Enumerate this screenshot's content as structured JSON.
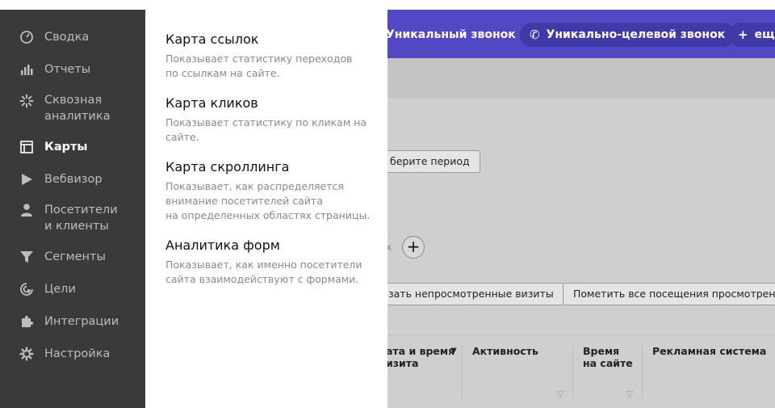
{
  "sidebar": {
    "items": [
      {
        "label": "Сводка",
        "icon": "gauge-icon",
        "active": false
      },
      {
        "label": "Отчеты",
        "icon": "bar-chart-icon",
        "active": false
      },
      {
        "label": "Сквозная\nаналитика",
        "icon": "loader-icon",
        "active": false
      },
      {
        "label": "Карты",
        "icon": "map-layout-icon",
        "active": true
      },
      {
        "label": "Вебвизор",
        "icon": "play-icon",
        "active": false
      },
      {
        "label": "Посетители\nи клиенты",
        "icon": "person-icon",
        "active": false
      },
      {
        "label": "Сегменты",
        "icon": "funnel-icon",
        "active": false
      },
      {
        "label": "Цели",
        "icon": "target-cursor-icon",
        "active": false
      },
      {
        "label": "Интеграции",
        "icon": "puzzle-icon",
        "active": false
      },
      {
        "label": "Настройка",
        "icon": "gear-icon",
        "active": false
      }
    ]
  },
  "flyout": {
    "items": [
      {
        "title": "Карта ссылок",
        "desc": "Показывает статистику переходов\nпо ссылкам на сайте."
      },
      {
        "title": "Карта кликов",
        "desc": "Показывает статистику по кликам на\nсайте."
      },
      {
        "title": "Карта скроллинга",
        "desc": "Показывает, как распределяется\nвнимание посетителей сайта\nна определенных областях страницы."
      },
      {
        "title": "Аналитика форм",
        "desc": "Показывает, как именно посетители\nсайта взаимодействуют с формами."
      }
    ]
  },
  "background": {
    "goals": [
      {
        "label": "Уникальный звонок",
        "icon": "phone-icon"
      },
      {
        "label": "Уникально-целевой звонок",
        "icon": "phone-icon"
      },
      {
        "label": "ещё",
        "icon": "plus-icon"
      }
    ],
    "period_button": "берите период",
    "faded_label": "х",
    "add_symbol": "+",
    "unviewed_button": "зать непросмотренные визиты",
    "mark_viewed_button": "Пометить все посещения просмотренными",
    "columns": [
      {
        "label": "ата и время\nизита",
        "sort": "▼"
      },
      {
        "label": "Активность"
      },
      {
        "label": "Время\nна сайте"
      },
      {
        "label": "Рекламная система"
      }
    ],
    "colors": {
      "goals_bar": "#5248c4",
      "sidebar": "#3a3a3a",
      "overlay": "#cfcfcf"
    }
  }
}
